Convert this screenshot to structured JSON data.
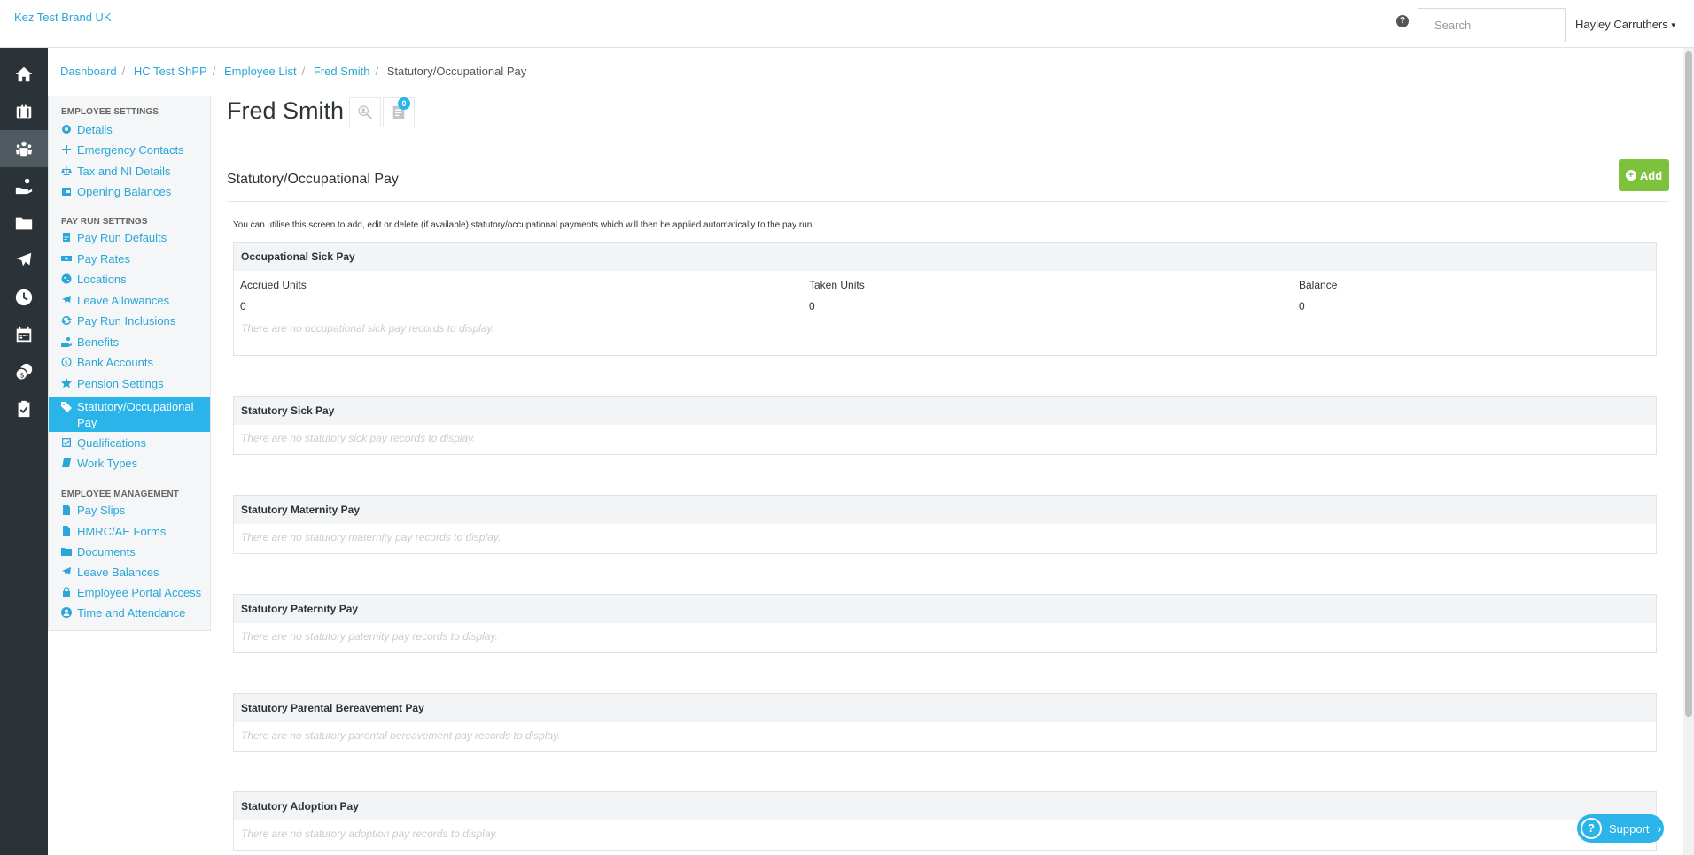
{
  "header": {
    "brand": "Kez Test Brand UK",
    "help_icon": "question-circle-icon",
    "search_placeholder": "Search",
    "user_name": "Hayley Carruthers"
  },
  "rail": {
    "items": [
      {
        "icon": "home-icon",
        "active": false
      },
      {
        "icon": "briefcase-icon",
        "active": false
      },
      {
        "icon": "employees-icon",
        "active": true
      },
      {
        "icon": "hand-coins-icon",
        "active": false
      },
      {
        "icon": "folder-icon",
        "active": false
      },
      {
        "icon": "plane-icon",
        "active": false
      },
      {
        "icon": "clock-icon",
        "active": false
      },
      {
        "icon": "calendar-icon",
        "active": false
      },
      {
        "icon": "coins-icon",
        "active": false
      },
      {
        "icon": "clipboard-check-icon",
        "active": false
      }
    ]
  },
  "breadcrumb": {
    "items": [
      "Dashboard",
      "HC Test ShPP",
      "Employee List",
      "Fred Smith"
    ],
    "current": "Statutory/Occupational Pay"
  },
  "sidebar": {
    "employee_settings_title": "Employee Settings",
    "employee_settings": [
      "Details",
      "Emergency Contacts",
      "Tax and NI Details",
      "Opening Balances"
    ],
    "pay_run_settings_title": "Pay Run Settings",
    "pay_run_settings": [
      "Pay Run Defaults",
      "Pay Rates",
      "Locations",
      "Leave Allowances",
      "Pay Run Inclusions",
      "Benefits",
      "Bank Accounts",
      "Pension Settings",
      "Statutory/Occupational Pay",
      "Qualifications",
      "Work Types"
    ],
    "employee_management_title": "Employee Management",
    "employee_management": [
      "Pay Slips",
      "HMRC/AE Forms",
      "Documents",
      "Leave Balances",
      "Employee Portal Access",
      "Time and Attendance"
    ],
    "active_item": "Statutory/Occupational Pay"
  },
  "main": {
    "employee_name": "Fred Smith",
    "notes_count": "0",
    "section_title": "Statutory/Occupational Pay",
    "add_label": "Add",
    "intro": "You can utilise this screen to add, edit or delete (if available) statutory/occupational payments which will then be applied automatically to the pay run.",
    "occupational_sick_pay": {
      "title": "Occupational Sick Pay",
      "columns": [
        {
          "label": "Accrued Units",
          "value": "0"
        },
        {
          "label": "Taken Units",
          "value": "0"
        },
        {
          "label": "Balance",
          "value": "0"
        }
      ],
      "empty": "There are no occupational sick pay records to display."
    },
    "panels": [
      {
        "title": "Statutory Sick Pay",
        "empty": "There are no statutory sick pay records to display."
      },
      {
        "title": "Statutory Maternity Pay",
        "empty": "There are no statutory maternity pay records to display."
      },
      {
        "title": "Statutory Paternity Pay",
        "empty": "There are no statutory paternity pay records to display."
      },
      {
        "title": "Statutory Parental Bereavement Pay",
        "empty": "There are no statutory parental bereavement pay records to display."
      },
      {
        "title": "Statutory Adoption Pay",
        "empty": "There are no statutory adoption pay records to display."
      }
    ]
  },
  "support": {
    "label": "Support"
  },
  "colors": {
    "accent": "#2ab4ea",
    "link": "#2aa7d8",
    "add": "#7dc13c",
    "rail": "#2b3338"
  }
}
